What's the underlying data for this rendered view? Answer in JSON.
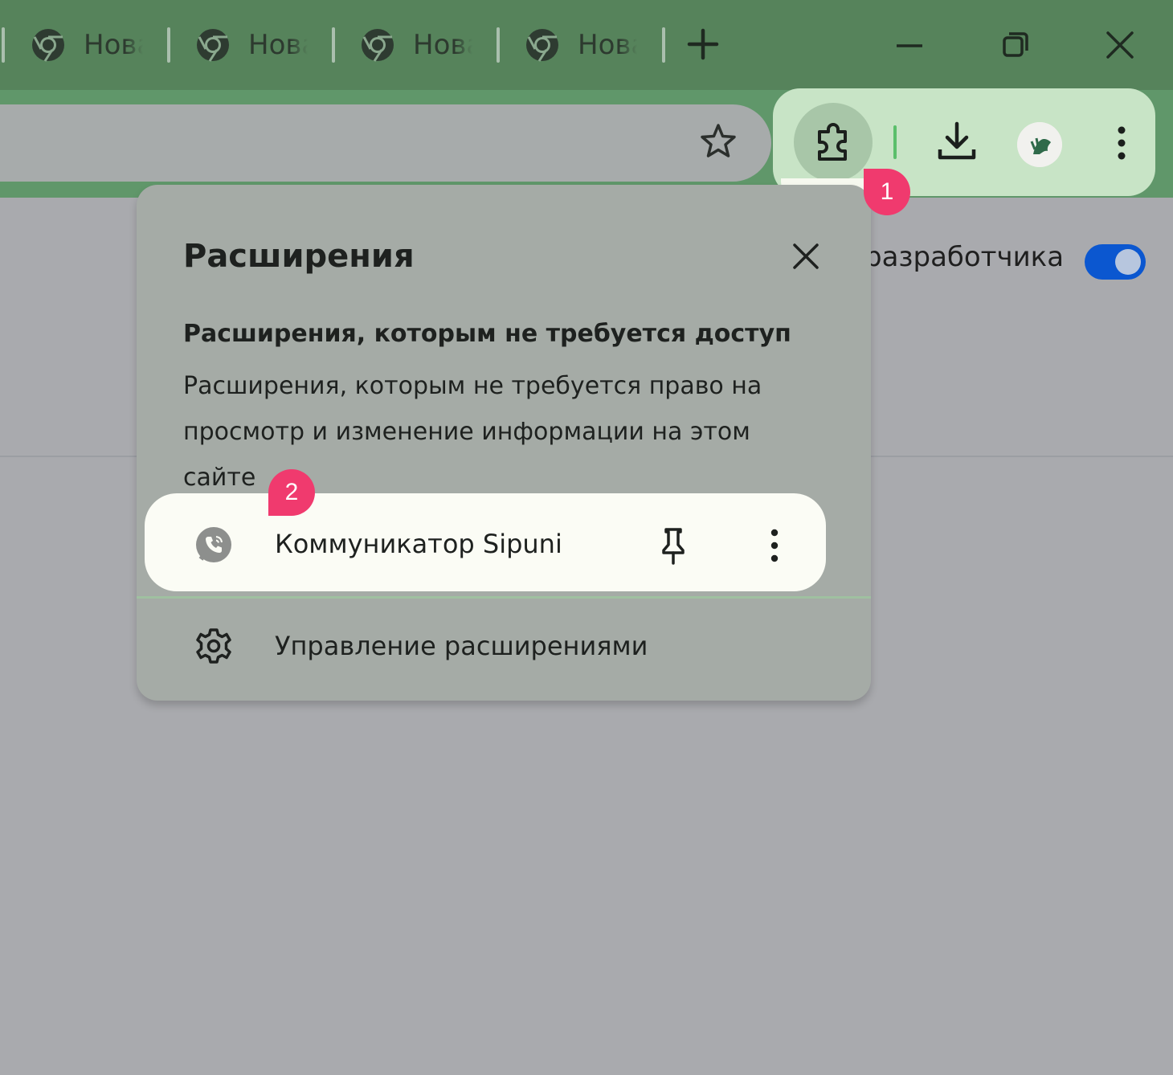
{
  "tabs": [
    {
      "title": "Нова"
    },
    {
      "title": "Нова"
    },
    {
      "title": "Нова"
    },
    {
      "title": "Нова"
    }
  ],
  "page": {
    "developer_mode_label": "разработчика"
  },
  "popup": {
    "title": "Расширения",
    "section_heading": "Расширения, которым не требуется доступ",
    "section_description": "Расширения, которым не требуется право на просмотр и изменение информации на этом сайте",
    "extension_name": "Коммуникатор Sipuni",
    "manage_label": "Управление расширениями"
  },
  "badges": {
    "step1": "1",
    "step2": "2"
  },
  "colors": {
    "tabstrip": "#56835b",
    "toolbar_highlight": "#c8e4c6",
    "toggle_on": "#0b57d0",
    "badge": "#f03a6e"
  }
}
